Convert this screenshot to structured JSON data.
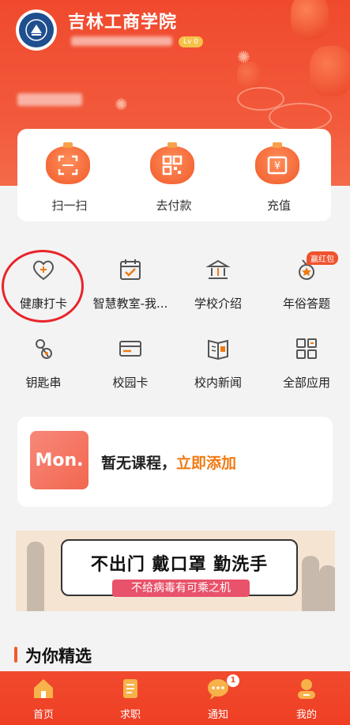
{
  "header": {
    "school_name": "吉林工商学院",
    "level_badge": "Lv 0"
  },
  "quick_actions": [
    {
      "label": "扫一扫",
      "icon": "scan-icon"
    },
    {
      "label": "去付款",
      "icon": "qrcode-pay-icon"
    },
    {
      "label": "充值",
      "icon": "recharge-icon"
    }
  ],
  "apps": [
    {
      "label": "健康打卡",
      "icon": "heart-plus-icon"
    },
    {
      "label": "智慧教室-我...",
      "icon": "calendar-check-icon"
    },
    {
      "label": "学校介绍",
      "icon": "school-building-icon"
    },
    {
      "label": "年俗答题",
      "icon": "medal-icon"
    },
    {
      "label": "钥匙串",
      "icon": "keychain-icon"
    },
    {
      "label": "校园卡",
      "icon": "campus-card-icon"
    },
    {
      "label": "校内新闻",
      "icon": "news-icon"
    },
    {
      "label": "全部应用",
      "icon": "all-apps-icon"
    }
  ],
  "red_packet_badge": "赢红包",
  "course": {
    "mon_label": "Mon.",
    "empty_text": "暂无课程，",
    "add_link": "立即添加"
  },
  "banner": {
    "title": "不出门 戴口罩 勤洗手",
    "subtitle": "不给病毒有可乘之机"
  },
  "section_title": "为你精选",
  "tabbar": {
    "tabs": [
      {
        "label": "首页",
        "icon": "home-icon"
      },
      {
        "label": "求职",
        "icon": "job-icon"
      },
      {
        "label": "通知",
        "icon": "chat-icon",
        "badge": "1"
      },
      {
        "label": "我的",
        "icon": "profile-icon"
      }
    ]
  },
  "colors": {
    "primary": "#f04a2e",
    "accent_orange": "#f07a12",
    "highlight_circle": "#e8242b"
  }
}
